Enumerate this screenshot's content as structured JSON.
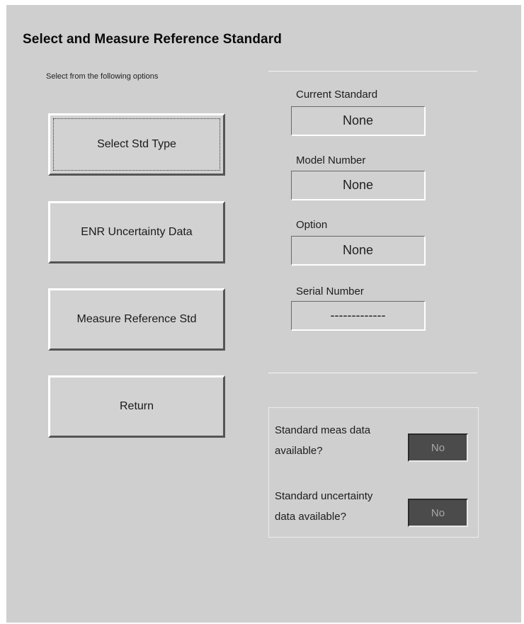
{
  "window": {
    "title": "Select and Measure Reference Standard",
    "instructions": "Select from the following options"
  },
  "buttons": {
    "select_std_type": "Select Std Type",
    "enr_uncertainty": "ENR Uncertainty Data",
    "measure_reference": "Measure Reference Std",
    "return": "Return"
  },
  "standard_info": {
    "current_standard": {
      "label": "Current Standard",
      "value": "None"
    },
    "model_number": {
      "label": "Model Number",
      "value": "None"
    },
    "option": {
      "label": "Option",
      "value": "None"
    },
    "serial_number": {
      "label": "Serial Number",
      "value": "-------------"
    }
  },
  "status": {
    "meas_data": {
      "label_line1": "Standard meas data",
      "label_line2": "available?",
      "value": "No"
    },
    "uncertainty_data": {
      "label_line1": "Standard uncertainty",
      "label_line2": "data available?",
      "value": "No"
    }
  },
  "colors": {
    "window_bg": "#cfcfcf",
    "indicator_bg": "#4b4b4b",
    "indicator_text": "#a8a8a8"
  }
}
